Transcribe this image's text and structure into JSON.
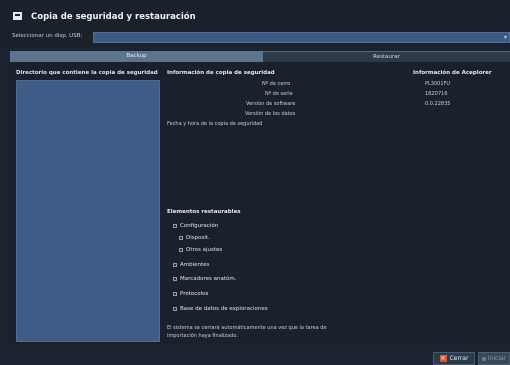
{
  "window": {
    "title": "Copia de seguridad y restauración",
    "icon": "window-icon"
  },
  "usb": {
    "label": "Seleccionar un disp. USB:",
    "selected": "",
    "arrow_icon": "chevron-down-icon"
  },
  "tabs": [
    {
      "label": "Backup",
      "active": true
    },
    {
      "label": "Restaurar",
      "active": false
    }
  ],
  "directory": {
    "title": "Directorio que contiene la copia de seguridad"
  },
  "backup_info": {
    "title": "Información de copia de seguridad",
    "fields": [
      {
        "label": "Nº de carro",
        "value": "PL3001FU"
      },
      {
        "label": "Nº de serie",
        "value": "18Z0716"
      },
      {
        "label": "Versión de software",
        "value": "0.0.22835"
      },
      {
        "label": "Versión de los datos",
        "value": ""
      },
      {
        "label": "Fecha y hora de la copia de seguridad",
        "value": ""
      }
    ]
  },
  "app_info": {
    "title": "Información de Aceplorer"
  },
  "restorable": {
    "title": "Elementos restaurables",
    "items": [
      {
        "label": "Configuración",
        "level": 0
      },
      {
        "label": "Disposit.",
        "level": 1
      },
      {
        "label": "Otros ajustes",
        "level": 1
      },
      {
        "label": "Ambientes",
        "level": 0
      },
      {
        "label": "Marcadores anatóm.",
        "level": 0
      },
      {
        "label": "Protocolos",
        "level": 0
      },
      {
        "label": "Base de datos de exploraciones",
        "level": 0
      }
    ]
  },
  "note": "El sistema se cerrará automáticamente una vez que la tarea de importación haya finalizado.",
  "buttons": {
    "close_label": "Cerrar",
    "start_label": "Iniciar"
  }
}
